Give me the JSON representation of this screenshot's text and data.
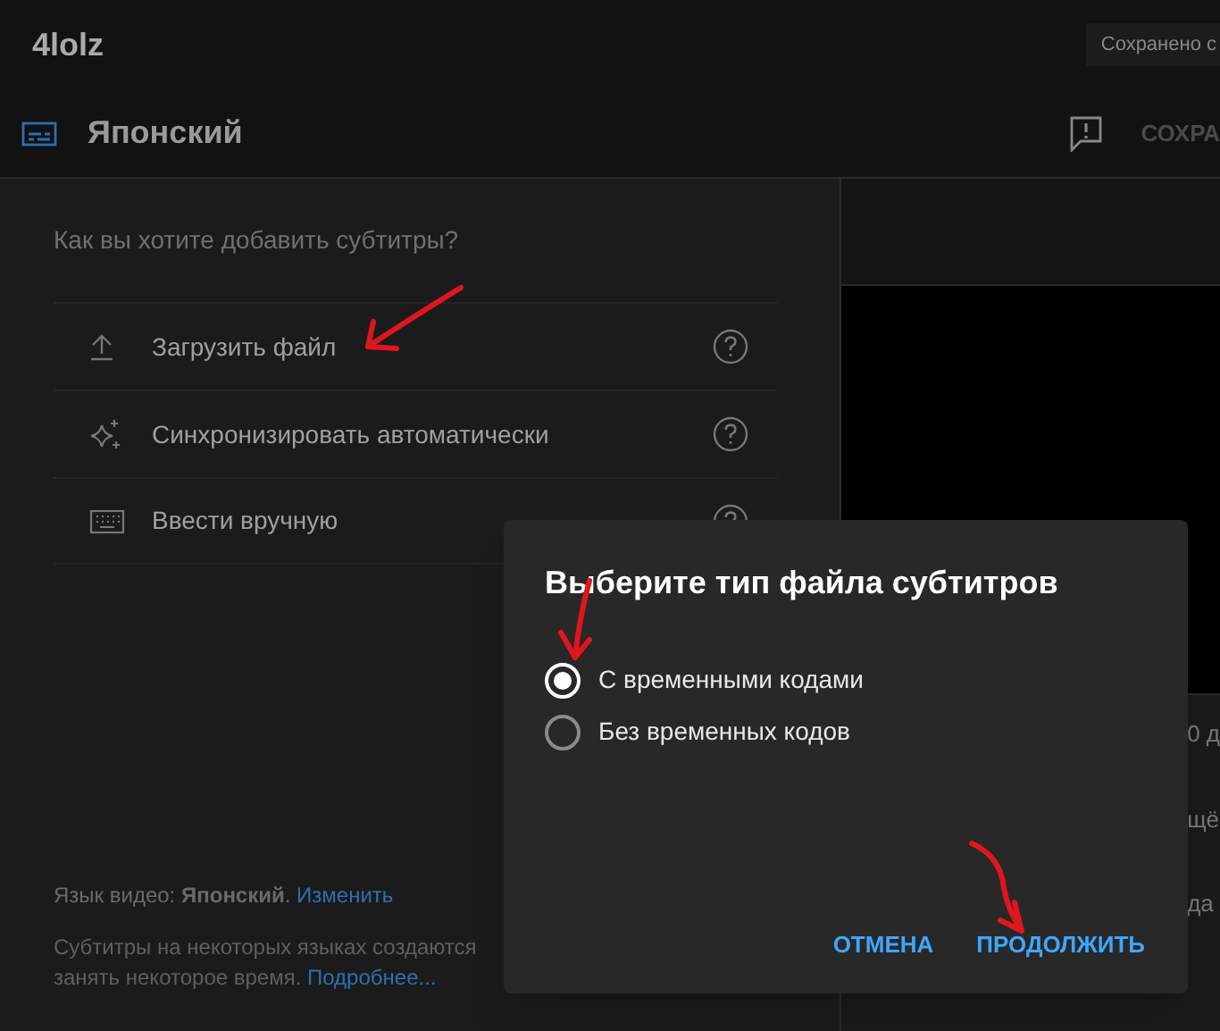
{
  "app": {
    "channel_name": "4lolz",
    "save_status": "Сохранено с"
  },
  "editor": {
    "language": "Японский",
    "save_button": "СОХРА"
  },
  "panel": {
    "question": "Как вы хотите добавить субтитры?",
    "options": [
      {
        "kind": "upload",
        "label": "Загрузить файл"
      },
      {
        "kind": "sync",
        "label": "Синхронизировать автоматически"
      },
      {
        "kind": "manual",
        "label": "Ввести вручную"
      }
    ],
    "video_language": {
      "text": "Язык видео: **Японский**.",
      "link": "Изменить"
    },
    "note": {
      "line_1": "Субтитры на некоторых языках создаются",
      "line_2": "занять некоторое время.",
      "link": "Подробнее..."
    }
  },
  "right_panel": {
    "fragments": [
      "0 д",
      "щё",
      "да"
    ]
  },
  "dialog": {
    "title": "Выберите тип файла субтитров",
    "options": [
      {
        "label": "С временными кодами",
        "selected": true
      },
      {
        "label": "Без временных кодов",
        "selected": false
      }
    ],
    "buttons": [
      "ОТМЕНА",
      "ПРОДОЛЖИТЬ"
    ]
  }
}
